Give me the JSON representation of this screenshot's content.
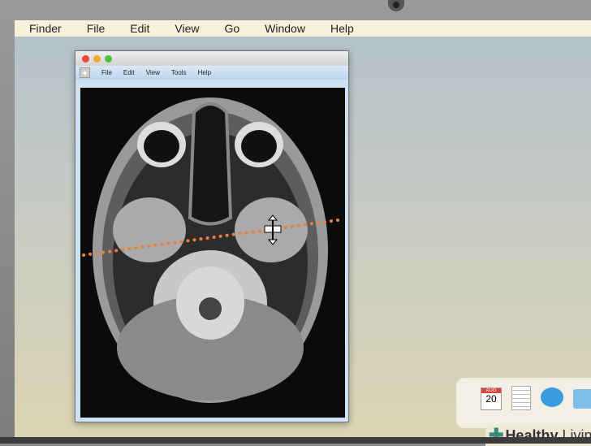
{
  "menubar": {
    "apple": "",
    "items": [
      "Finder",
      "File",
      "Edit",
      "View",
      "Go",
      "Window",
      "Help"
    ]
  },
  "window": {
    "menu": [
      "File",
      "Edit",
      "View",
      "Tools",
      "Help"
    ]
  },
  "dock": {
    "calendar_month": "AUG",
    "calendar_day": "20",
    "icons": [
      "calendar-icon",
      "notes-icon",
      "messages-icon",
      "downloads-folder-icon"
    ]
  },
  "brand": {
    "bold": "Healthy",
    "light": "Living"
  },
  "colors": {
    "accent_line": "#e8823a"
  }
}
